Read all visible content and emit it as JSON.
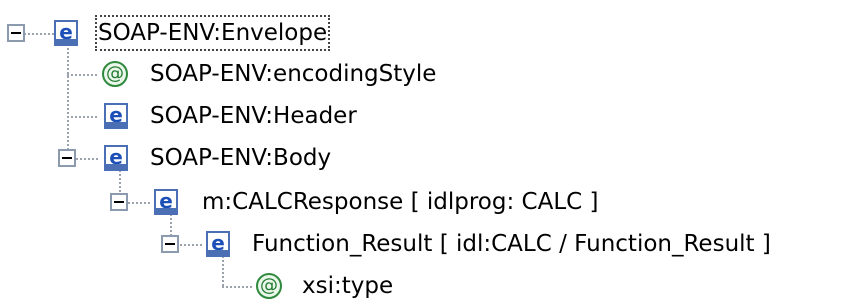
{
  "tree": {
    "nodes": [
      {
        "id": "envelope",
        "label": "SOAP-ENV:Envelope",
        "icon": "element-icon",
        "icon_glyph": "e",
        "expanded": true,
        "selected": true
      },
      {
        "id": "encstyle",
        "label": "SOAP-ENV:encodingStyle",
        "icon": "attribute-icon",
        "icon_glyph": "@"
      },
      {
        "id": "header",
        "label": "SOAP-ENV:Header",
        "icon": "element-icon",
        "icon_glyph": "e"
      },
      {
        "id": "body",
        "label": "SOAP-ENV:Body",
        "icon": "element-icon",
        "icon_glyph": "e",
        "expanded": true
      },
      {
        "id": "calc",
        "label": "m:CALCResponse  [ idlprog: CALC ]",
        "icon": "element-icon",
        "icon_glyph": "e",
        "expanded": true
      },
      {
        "id": "funcres",
        "label": "Function_Result  [ idl:CALC / Function_Result ]",
        "icon": "element-icon",
        "icon_glyph": "e",
        "expanded": true
      },
      {
        "id": "xsitype",
        "label": "xsi:type",
        "icon": "attribute-icon",
        "icon_glyph": "@"
      }
    ]
  }
}
